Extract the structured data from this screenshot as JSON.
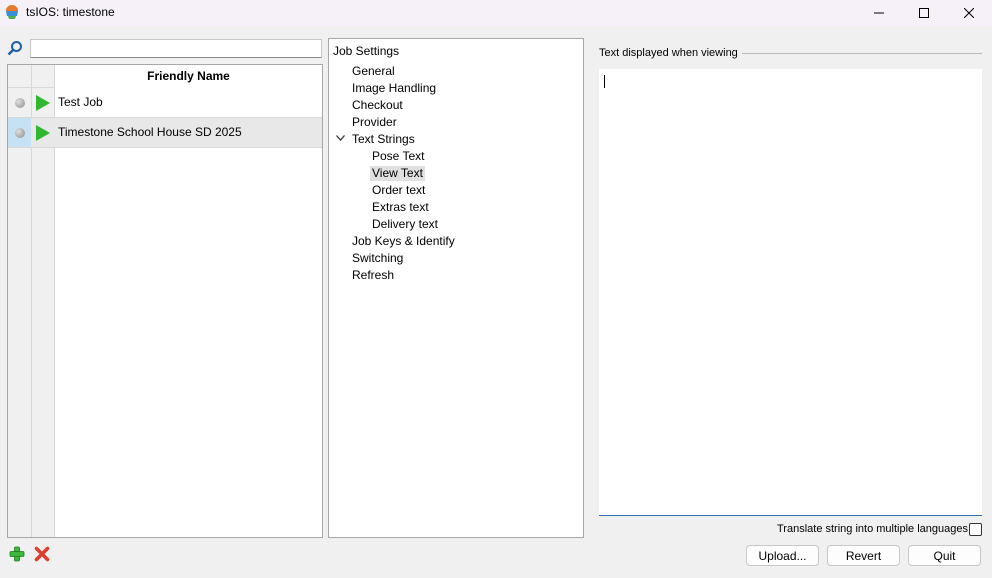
{
  "window": {
    "title": "tsIOS: timestone",
    "icons": {
      "app": "app-icon",
      "minimize": "minimize-icon",
      "maximize": "maximize-icon",
      "close": "close-icon"
    }
  },
  "search": {
    "value": "",
    "icon": "search-icon"
  },
  "jobs_table": {
    "header": "Friendly Name",
    "rows": [
      {
        "name": "Test Job",
        "status_icon": "gray-dot-icon",
        "action_icon": "play-icon"
      },
      {
        "name": "Timestone School House SD 2025",
        "status_icon": "gray-dot-icon",
        "action_icon": "play-icon",
        "selected": true
      }
    ]
  },
  "job_actions": {
    "add_icon": "add-plus-icon",
    "delete_icon": "delete-x-icon"
  },
  "settings_tree": {
    "root": "Job Settings",
    "items": [
      "General",
      "Image Handling",
      "Checkout",
      "Provider",
      "Text Strings",
      "Job Keys & Identify",
      "Switching",
      "Refresh"
    ],
    "text_strings_children": [
      "Pose Text",
      "View Text",
      "Order text",
      "Extras text",
      "Delivery text"
    ],
    "selected": "View Text"
  },
  "editor": {
    "group_title": "Text displayed when viewing",
    "value": "",
    "translate_label": "Translate string into multiple languages",
    "translate_checked": false
  },
  "buttons": {
    "upload": "Upload...",
    "revert": "Revert",
    "quit": "Quit"
  },
  "colors": {
    "accent": "#2f6fb6",
    "play_green": "#2fb82f",
    "delete_red": "#e03c2c",
    "selection": "#c6e0f4"
  }
}
